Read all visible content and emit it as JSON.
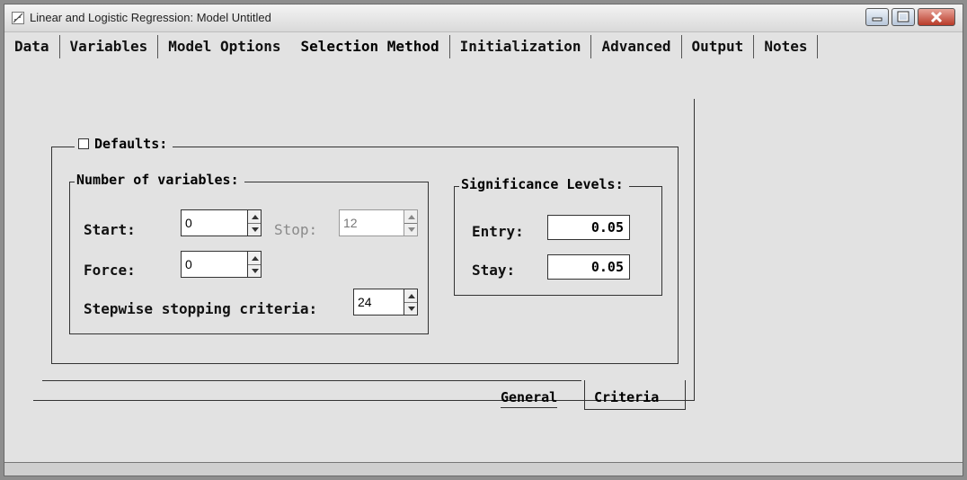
{
  "window": {
    "title": "Linear and Logistic Regression: Model Untitled"
  },
  "tabs": [
    "Data",
    "Variables",
    "Model Options",
    "Selection Method",
    "Initialization",
    "Advanced",
    "Output",
    "Notes"
  ],
  "defaults": {
    "label": "Defaults:",
    "checked": false
  },
  "number_of_variables": {
    "label": "Number of variables:",
    "start_label": "Start:",
    "start_value": "0",
    "stop_label": "Stop:",
    "stop_value": "12",
    "force_label": "Force:",
    "force_value": "0",
    "stepwise_label": "Stepwise stopping criteria:",
    "stepwise_value": "24"
  },
  "significance": {
    "label": "Significance Levels:",
    "entry_label": "Entry:",
    "entry_value": "0.05",
    "stay_label": "Stay:",
    "stay_value": "0.05"
  },
  "subtabs": {
    "general": "General",
    "criteria": "Criteria",
    "active": "Criteria"
  },
  "icons": {
    "app": "regression-chart-icon",
    "minimize": "minimize-icon",
    "maximize": "maximize-icon",
    "close": "close-icon"
  }
}
